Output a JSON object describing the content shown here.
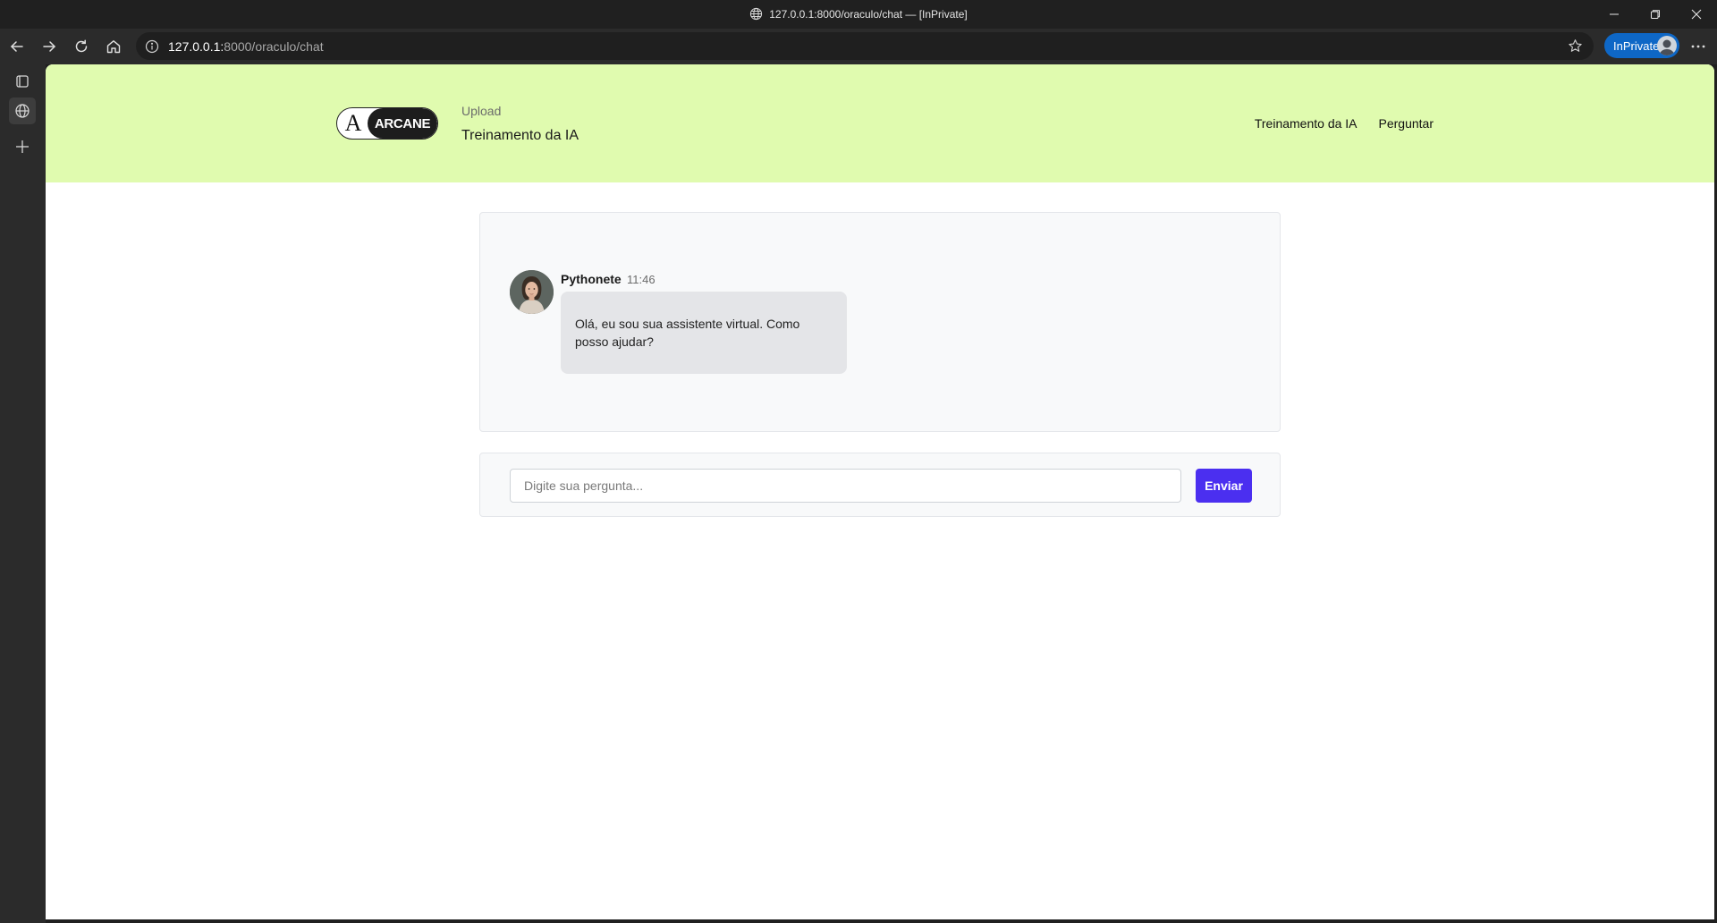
{
  "browser": {
    "window_title": "127.0.0.1:8000/oraculo/chat — [InPrivate]",
    "url_host": "127.0.0.1:",
    "url_path": "8000/oraculo/chat",
    "inprivate_label": "InPrivate",
    "accent": "#0e67c6"
  },
  "header": {
    "logo_mark": "A",
    "logo_text": "ARCANE",
    "subtitle": "Upload",
    "title": "Treinamento da IA",
    "background": "#e0fbaf",
    "nav": [
      {
        "label": "Treinamento da IA"
      },
      {
        "label": "Perguntar"
      }
    ]
  },
  "chat": {
    "messages": [
      {
        "author": "Pythonete",
        "time": "11:46",
        "text": "Olá, eu sou sua assistente virtual. Como posso ajudar?",
        "avatar_icon": "woman-avatar"
      }
    ]
  },
  "composer": {
    "placeholder": "Digite sua pergunta...",
    "value": "",
    "send_label": "Enviar",
    "send_color": "#4b2ff0"
  }
}
